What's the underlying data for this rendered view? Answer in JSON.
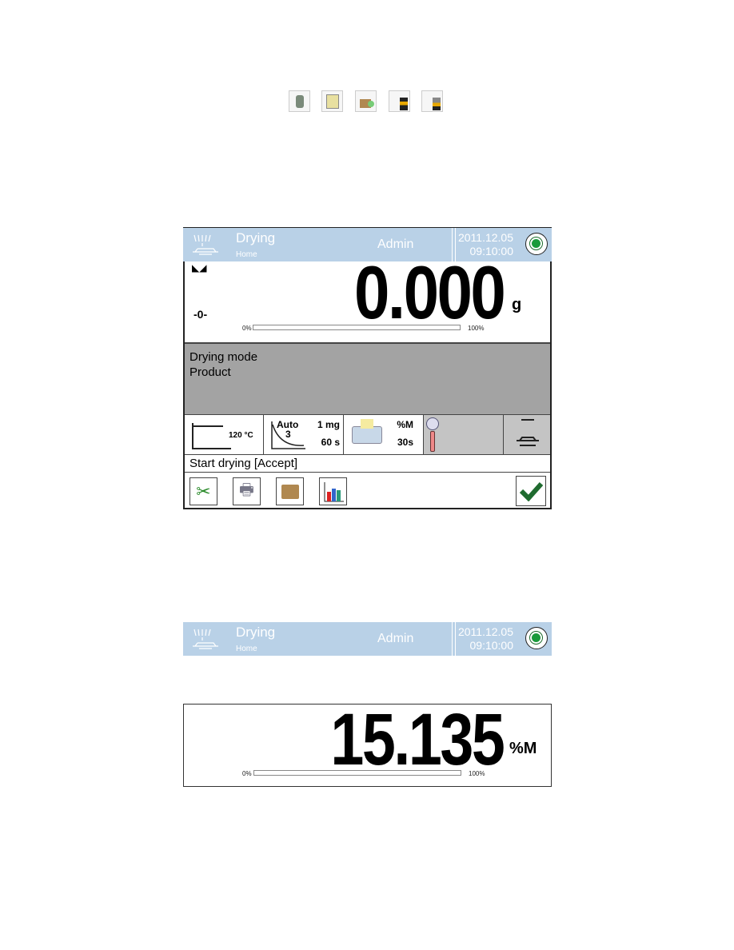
{
  "top_icons": [
    "operator-icon",
    "program-icon",
    "product-database-icon",
    "printout-header-icon",
    "printout-footer-icon"
  ],
  "header": {
    "title": "Drying",
    "subtitle": "Home",
    "user": "Admin",
    "date": "2011.12.05",
    "time": "09:10:00"
  },
  "weighing": {
    "stability_marker": "◣◢",
    "zero_indicator": "-0-",
    "value": "0.000",
    "unit": "g",
    "bar_min": "0%",
    "bar_max": "100%",
    "progress": 0
  },
  "info": {
    "line1": "Drying mode",
    "line2": "Product"
  },
  "status": {
    "temperature": "120 °C",
    "finish_mode": "Auto",
    "finish_mode_value": "3",
    "mass_change": "1 mg",
    "time_interval": "60 s",
    "print_unit": "%M",
    "print_interval": "30s"
  },
  "prompt": "Start drying [Accept]",
  "toolbar": [
    "settings-icon",
    "drying-printouts-icon",
    "product-database-icon",
    "drying-chart-icon"
  ],
  "accept_icon": "checkmark-icon",
  "result": {
    "value": "15.135",
    "unit": "%M",
    "bar_min": "0%",
    "bar_max": "100%",
    "progress": 0
  },
  "colors": {
    "header": "#b9d1e7",
    "info_panel": "#a3a3a3",
    "accept": "#1f6b2f"
  }
}
